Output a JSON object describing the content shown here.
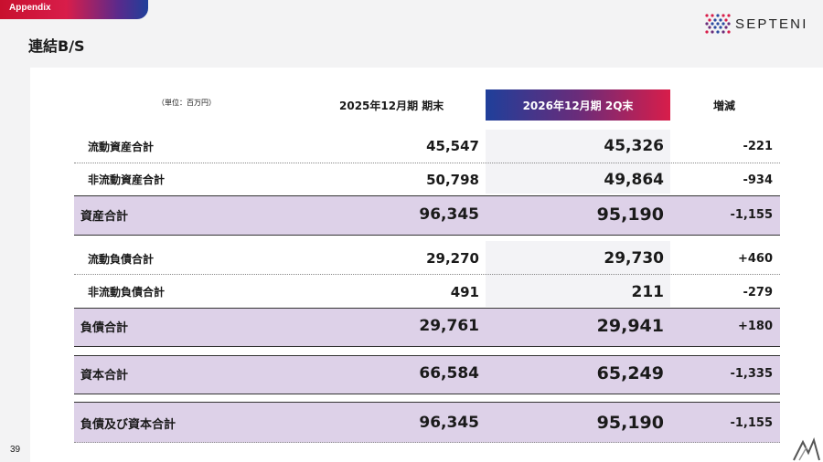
{
  "header": {
    "tag": "Appendix",
    "title": "連結B/S",
    "logo_text": "SEPTENI",
    "page_number": "39"
  },
  "table": {
    "unit": "（単位：百万円）",
    "col_prev": "2025年12月期 期末",
    "col_cur": "2026年12月期 2Q末",
    "col_diff": "増減",
    "rows": [
      {
        "label": "流動資産合計",
        "prev": "45,547",
        "cur": "45,326",
        "diff": "-221"
      },
      {
        "label": "非流動資産合計",
        "prev": "50,798",
        "cur": "49,864",
        "diff": "-934"
      },
      {
        "label": "資産合計",
        "prev": "96,345",
        "cur": "95,190",
        "diff": "-1,155"
      },
      {
        "label": "流動負債合計",
        "prev": "29,270",
        "cur": "29,730",
        "diff": "+460"
      },
      {
        "label": "非流動負債合計",
        "prev": "491",
        "cur": "211",
        "diff": "-279"
      },
      {
        "label": "負債合計",
        "prev": "29,761",
        "cur": "29,941",
        "diff": "+180"
      },
      {
        "label": "資本合計",
        "prev": "66,584",
        "cur": "65,249",
        "diff": "-1,335"
      },
      {
        "label": "負債及び資本合計",
        "prev": "96,345",
        "cur": "95,190",
        "diff": "-1,155"
      }
    ]
  },
  "colors": {
    "total_row_bg": "#ddd1e8",
    "accent_red": "#d81d4a",
    "accent_blue": "#1f3f9a"
  }
}
